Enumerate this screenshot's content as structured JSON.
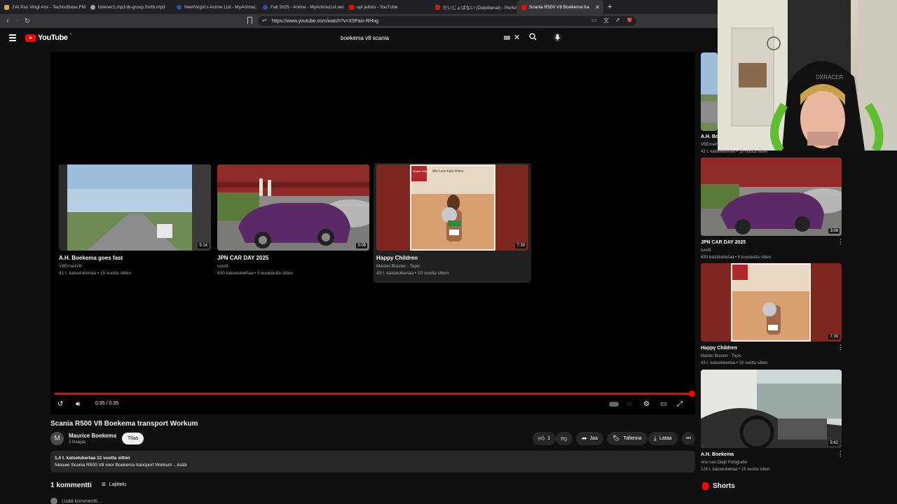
{
  "browser": {
    "tabs": [
      {
        "label": "J'Ai Pas Vingt Ans - TechnoBase.FM",
        "fav": "#e8a33a"
      },
      {
        "label": "listener1.mp3.tb-group.fm/tb.mp3",
        "fav": "#9aa0a6"
      },
      {
        "label": "NeetVirgin's Anime List - MyAnimeL",
        "fav": "#2e51a2"
      },
      {
        "label": "Fall 2025 - Anime - MyAnimeList.net",
        "fav": "#2e51a2"
      },
      {
        "label": "upi jeltsin - YouTube",
        "fav": "#ff0000"
      },
      {
        "label": "だいじょばない (Daijobanai) - Perfume",
        "fav": "#ff0000"
      },
      {
        "label": "Scania R500 V8 Boekema tra",
        "fav": "#ff0000",
        "active": true
      }
    ],
    "new_tab": "+",
    "url": "https://www.youtube.com/watch?v=X5Paix-RHng"
  },
  "youtube": {
    "logo": "YouTube",
    "logo_sup": "FI",
    "search_query": "boekema v8 scania",
    "end_screen": [
      {
        "title": "A.H. Boekema goes fast",
        "channel": "V8EmielV8",
        "meta": "41 t. katselukertaa • 15 vuotta sitten",
        "duration": "9:14"
      },
      {
        "title": "JPN CAR DAY 2025",
        "channel": "luce9",
        "meta": "630 katselukertaa • 5 kuukautta sitten",
        "duration": "3:06"
      },
      {
        "title": "Happy Children",
        "channel": "Master Blaster - Topic",
        "meta": "43 t. katselukertaa • 10 vuotta sitten",
        "duration": "7:39"
      }
    ],
    "player": {
      "time": "0:35 / 0:35",
      "progress_fraction": 1.0
    },
    "album": {
      "brand": "Master Blaster",
      "title": "We Love Italo Disco"
    },
    "video_title": "Scania R500 V8 Boekema transport Workum",
    "channel": {
      "avatar_letter": "M",
      "name": "Maurice Boekema",
      "subs": "3 tilaajaa"
    },
    "subscribe": "Tilaa",
    "actions": {
      "likes": "1",
      "share": "Jaa",
      "save": "Tallenna",
      "download": "Lataa"
    },
    "description": {
      "stats": "1,4 t. katselukertaa  12 vuotta sitten",
      "text": "Nieuwe Scania R500 V8 voor Boekema transport Workum ...lisää"
    },
    "comments": {
      "count": "1 kommentti",
      "sort": "Lajittelu",
      "add": "Lisää kommentti..."
    },
    "sidebar": [
      {
        "title": "A.H. Bo",
        "channel": "V8EmielV",
        "meta": "41 t. katselukertaa • 15 vuotta sitten"
      },
      {
        "title": "JPN CAR DAY 2025",
        "channel": "luce9",
        "meta": "630 katselukertaa • 5 kuukautta sitten",
        "duration": "3:06"
      },
      {
        "title": "Happy Children",
        "channel": "Master Blaster - Topic",
        "meta": "43 t. katselukertaa • 10 vuotta sitten",
        "duration": "7:39"
      },
      {
        "title": "A.H. Boekema",
        "channel": "Arie van Duijn Fotografie",
        "meta": "124 t. katselukertaa • 15 vuotta sitten",
        "duration": "5:42"
      }
    ],
    "shorts": "Shorts"
  },
  "colors": {
    "accent": "#ff0000",
    "bg": "#0f0f0f"
  }
}
